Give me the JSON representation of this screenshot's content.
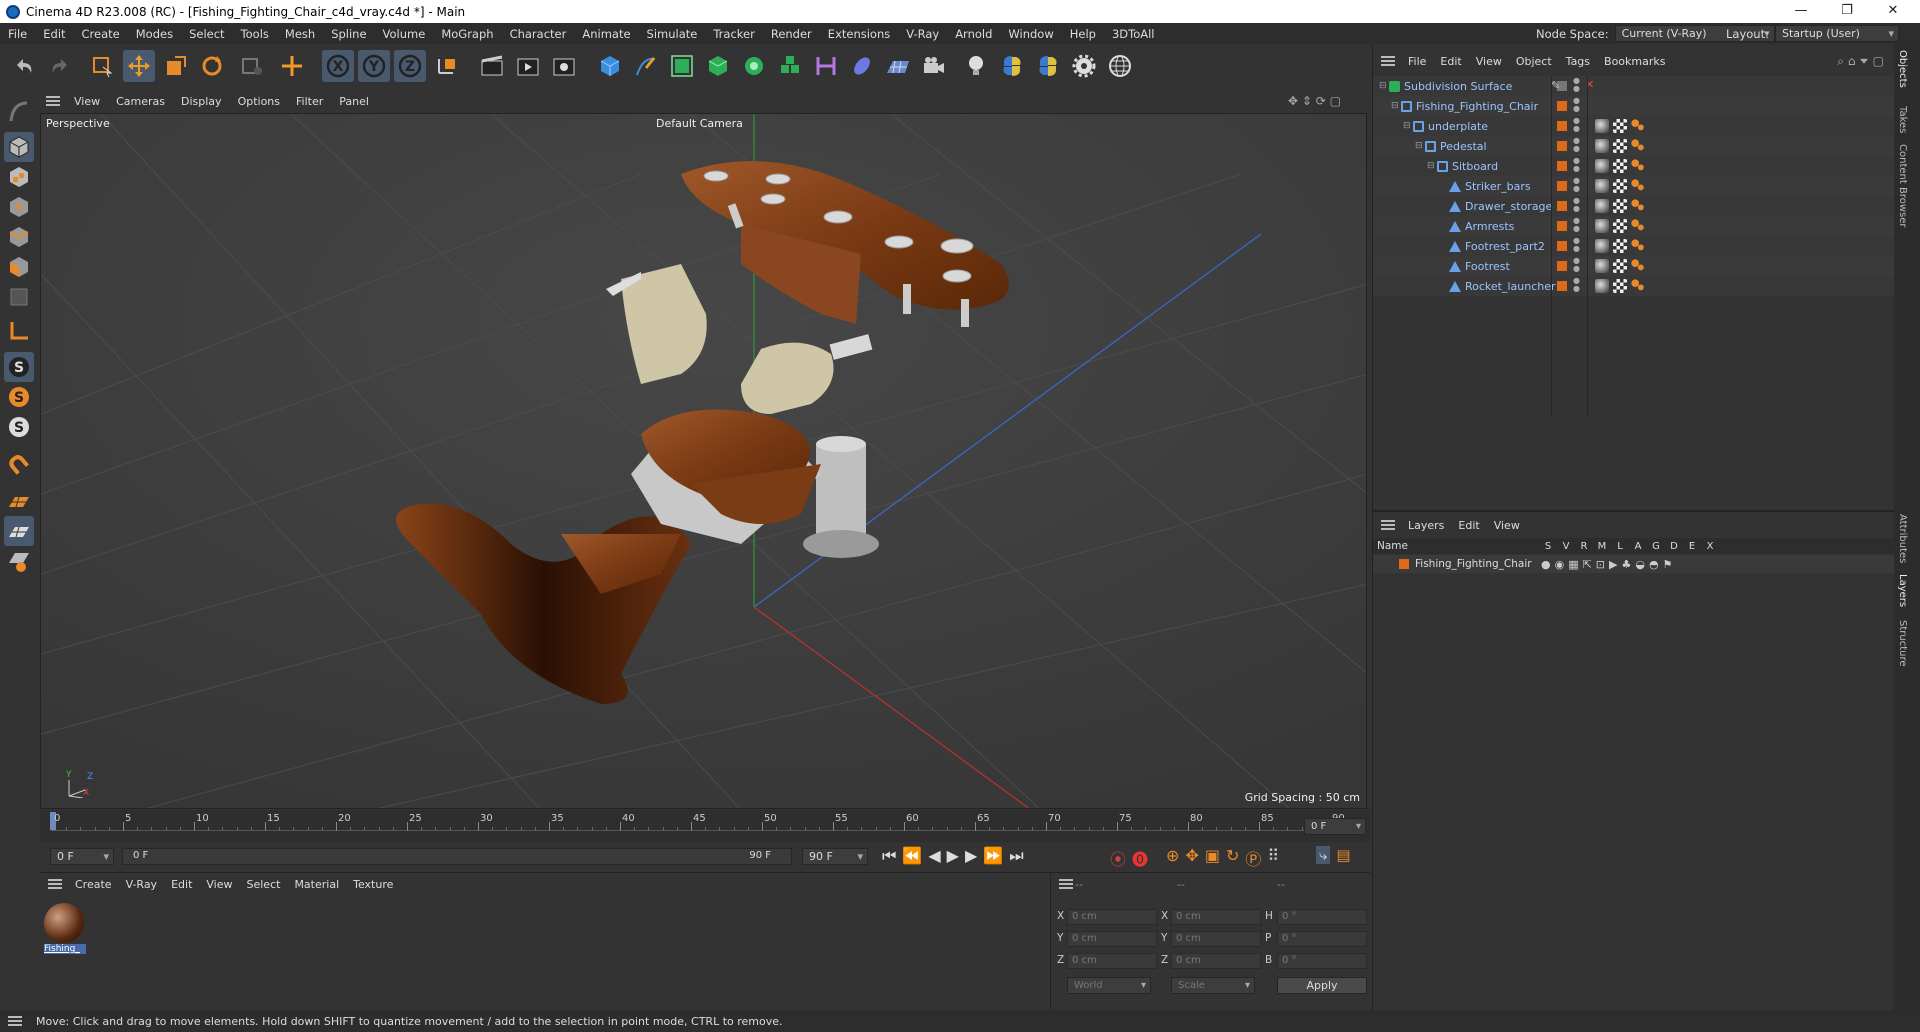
{
  "window": {
    "title": "Cinema 4D R23.008 (RC) - [Fishing_Fighting_Chair_c4d_vray.c4d *] - Main",
    "controls": [
      "—",
      "❐",
      "✕"
    ]
  },
  "menubar": {
    "items": [
      "File",
      "Edit",
      "Create",
      "Modes",
      "Select",
      "Tools",
      "Mesh",
      "Spline",
      "Volume",
      "MoGraph",
      "Character",
      "Animate",
      "Simulate",
      "Tracker",
      "Render",
      "Extensions",
      "V-Ray",
      "Arnold",
      "Window",
      "Help",
      "3DToAll"
    ],
    "node_space_label": "Node Space:",
    "node_space_value": "Current (V-Ray)",
    "layout_label": "Layout:",
    "layout_value": "Startup (User)"
  },
  "viewport": {
    "menu": [
      "View",
      "Cameras",
      "Display",
      "Options",
      "Filter",
      "Panel"
    ],
    "label": "Perspective",
    "camera": "Default Camera",
    "grid_spacing": "Grid Spacing : 50 cm",
    "axis_y": "Y",
    "axis_z": "Z",
    "axis_x": "X"
  },
  "timeline": {
    "ticks": [
      "0",
      "5",
      "10",
      "15",
      "20",
      "25",
      "30",
      "35",
      "40",
      "45",
      "50",
      "55",
      "60",
      "65",
      "70",
      "75",
      "80",
      "85",
      "90"
    ],
    "current_frame_right": "0 F",
    "start_field": "0 F",
    "range_start": "0 F",
    "range_end": "90 F",
    "end_field": "90 F"
  },
  "objects_panel": {
    "menu": [
      "File",
      "Edit",
      "View",
      "Object",
      "Tags",
      "Bookmarks"
    ],
    "tree": [
      {
        "name": "Subdivision Surface",
        "level": 0,
        "icon": "subdivision-icon"
      },
      {
        "name": "Fishing_Fighting_Chair",
        "level": 1,
        "icon": "null-icon"
      },
      {
        "name": "underplate",
        "level": 2,
        "icon": "null-icon"
      },
      {
        "name": "Pedestal",
        "level": 3,
        "icon": "null-icon"
      },
      {
        "name": "Sitboard",
        "level": 4,
        "icon": "null-icon"
      },
      {
        "name": "Striker_bars",
        "level": 5,
        "icon": "polygon-icon"
      },
      {
        "name": "Drawer_storage",
        "level": 5,
        "icon": "polygon-icon"
      },
      {
        "name": "Armrests",
        "level": 5,
        "icon": "polygon-icon"
      },
      {
        "name": "Footrest_part2",
        "level": 5,
        "icon": "polygon-icon"
      },
      {
        "name": "Footrest",
        "level": 5,
        "icon": "polygon-icon"
      },
      {
        "name": "Rocket_launcher",
        "level": 5,
        "icon": "polygon-icon"
      }
    ]
  },
  "layers_panel": {
    "menu": [
      "Layers",
      "Edit",
      "View"
    ],
    "col_name": "Name",
    "cols": [
      "S",
      "V",
      "R",
      "M",
      "L",
      "A",
      "G",
      "D",
      "E",
      "X"
    ],
    "layer_name": "Fishing_Fighting_Chair",
    "layer_color": "#e06a1c"
  },
  "material_panel": {
    "menu": [
      "Create",
      "V-Ray",
      "Edit",
      "View",
      "Select",
      "Material",
      "Texture"
    ],
    "material_label": "Fishing_"
  },
  "coord_panel": {
    "header": [
      "--",
      "--",
      "--"
    ],
    "rows": [
      {
        "a": "X",
        "av": "0 cm",
        "b": "X",
        "bv": "0 cm",
        "c": "H",
        "cv": "0 °"
      },
      {
        "a": "Y",
        "av": "0 cm",
        "b": "Y",
        "bv": "0 cm",
        "c": "P",
        "cv": "0 °"
      },
      {
        "a": "Z",
        "av": "0 cm",
        "b": "Z",
        "bv": "0 cm",
        "c": "B",
        "cv": "0 °"
      }
    ],
    "space": "World",
    "mode": "Scale",
    "apply": "Apply"
  },
  "right_tabs": [
    "Objects",
    "Takes",
    "Content Browser",
    "Attributes",
    "Layers",
    "Structure"
  ],
  "status": "Move: Click and drag to move elements. Hold down SHIFT to quantize movement / add to the selection in point mode, CTRL to remove.",
  "colors": {
    "accent": "#e06a1c",
    "select": "#4a5a6e",
    "wood": "#8a4a1e"
  }
}
